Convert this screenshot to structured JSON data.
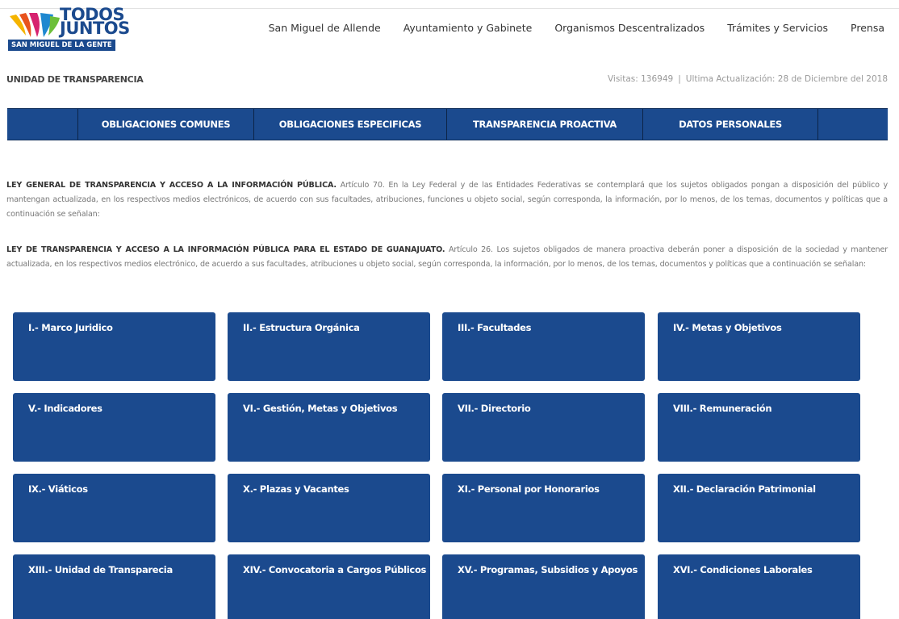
{
  "logo": {
    "line1": "TODOS",
    "line2": "JUNTOS",
    "tagline": "SAN MIGUEL DE LA GENTE"
  },
  "top_nav": [
    {
      "label": "San Miguel de Allende"
    },
    {
      "label": "Ayuntamiento y Gabinete"
    },
    {
      "label": "Organismos Descentralizados"
    },
    {
      "label": "Trámites y Servicios"
    },
    {
      "label": "Prensa"
    }
  ],
  "info": {
    "title": "UNIDAD DE TRANSPARENCIA",
    "visits": "Visitas: 136949",
    "separator": "|",
    "updated": "Ultima Actualización: 28 de Diciembre del 2018"
  },
  "main_nav": [
    {
      "label": "OBLIGACIONES COMUNES"
    },
    {
      "label": "OBLIGACIONES ESPECIFICAS"
    },
    {
      "label": "TRANSPARENCIA PROACTIVA"
    },
    {
      "label": "DATOS PERSONALES"
    }
  ],
  "paragraphs": [
    {
      "bold": "LEY GENERAL DE TRANSPARENCIA Y ACCESO A LA INFORMACIÓN PÚBLICA.",
      "text": " Artículo 70. En la Ley Federal y de las Entidades Federativas se contemplará que los sujetos obligados pongan a disposición del público y mantengan actualizada, en los respectivos medios electrónicos, de acuerdo con sus facultades, atribuciones, funciones u objeto social, según corresponda, la información, por lo menos, de los temas, documentos y políticas que a continuación se señalan:"
    },
    {
      "bold": "LEY DE TRANSPARENCIA Y ACCESO A LA INFORMACIÓN PÚBLICA PARA EL ESTADO DE GUANAJUATO.",
      "text": " Artículo 26. Los sujetos obligados de manera proactiva deberán poner a disposición de la sociedad y mantener actualizada, en los respectivos medios electrónico, de acuerdo a sus facultades, atribuciones u objeto social, según corresponda, la información, por lo menos, de los temas, documentos y políticas que a continuación se señalan:"
    }
  ],
  "tiles": [
    {
      "label": "I.- Marco Juridico"
    },
    {
      "label": "II.- Estructura Orgánica"
    },
    {
      "label": "III.- Facultades"
    },
    {
      "label": "IV.- Metas y Objetivos"
    },
    {
      "label": "V.- Indicadores"
    },
    {
      "label": "VI.- Gestión, Metas y Objetivos"
    },
    {
      "label": "VII.- Directorio"
    },
    {
      "label": "VIII.- Remuneración"
    },
    {
      "label": "IX.- Viáticos"
    },
    {
      "label": "X.- Plazas y Vacantes"
    },
    {
      "label": "XI.- Personal por Honorarios"
    },
    {
      "label": "XII.- Declaración Patrimonial"
    },
    {
      "label": "XIII.- Unidad de Transparecia"
    },
    {
      "label": "XIV.- Convocatoria a Cargos Públicos"
    },
    {
      "label": "XV.- Programas, Subsidios y Apoyos"
    },
    {
      "label": "XVI.- Condiciones Laborales"
    }
  ],
  "colors": {
    "brand_blue": "#1b4a8e",
    "nav_border": "#0f2e5a",
    "logo_yellow": "#f5b400",
    "logo_orange": "#e8521d",
    "logo_pink": "#d6226f",
    "logo_blue": "#1e88d0"
  }
}
